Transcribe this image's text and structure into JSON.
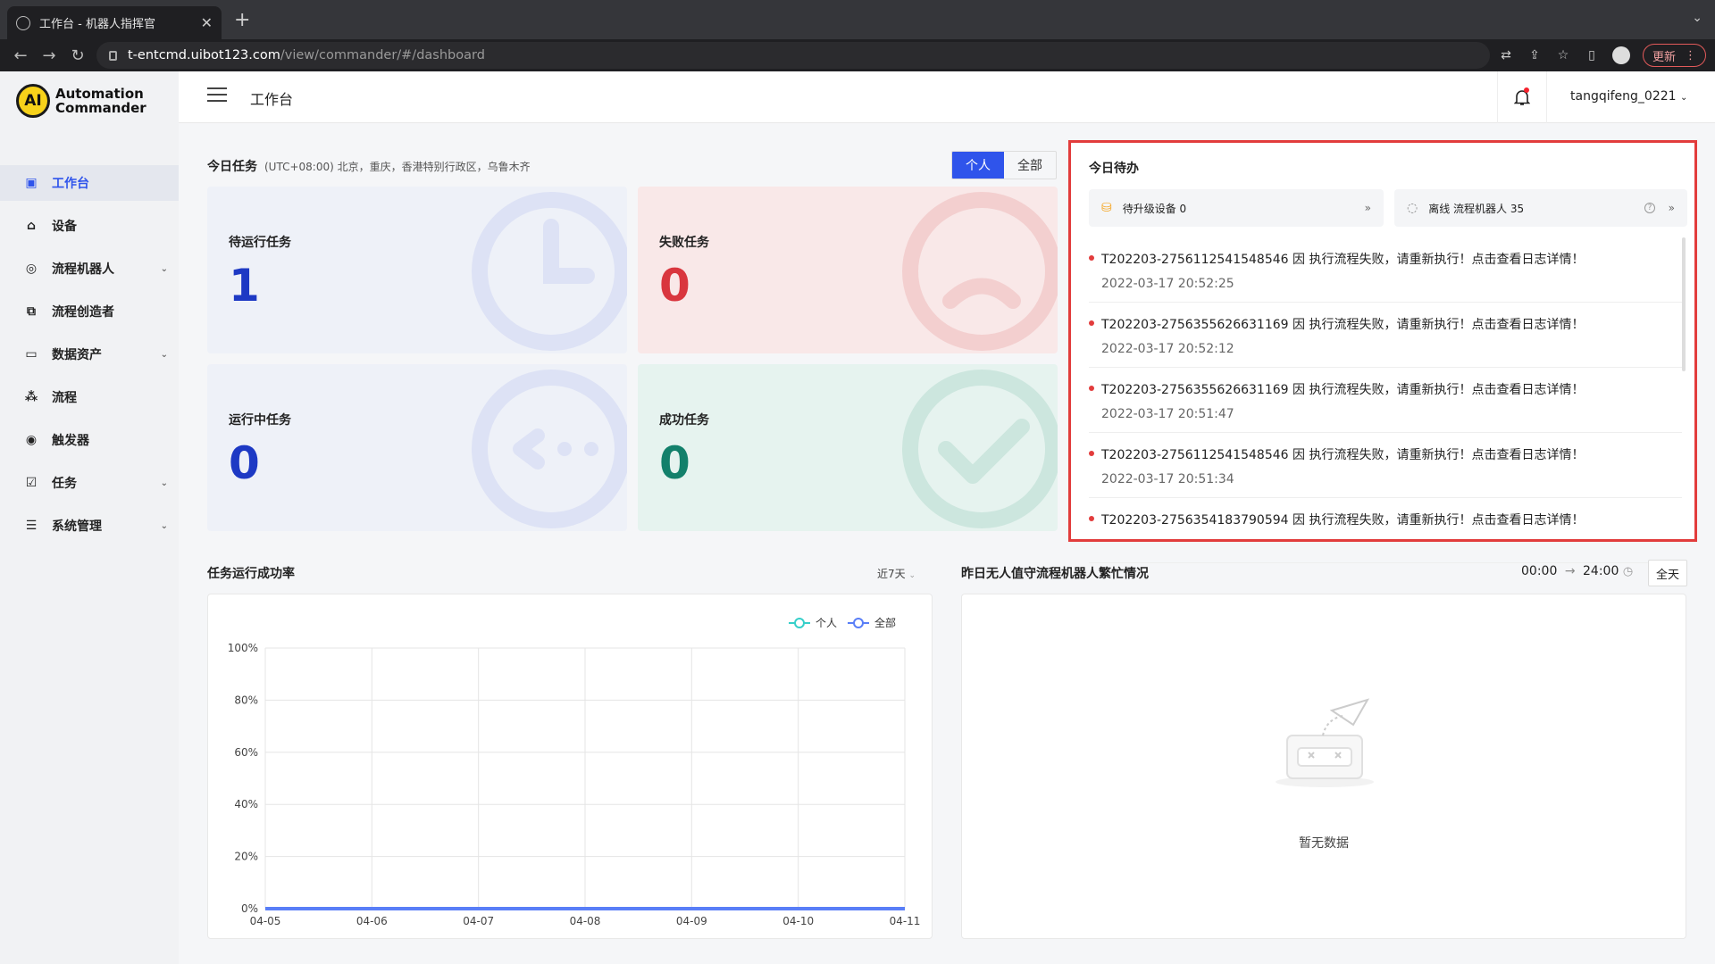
{
  "browser": {
    "tab_title": "工作台 - 机器人指挥官",
    "url_host": "t-entcmd.uibot123.com",
    "url_path": "/view/commander/#/dashboard",
    "update_label": "更新"
  },
  "brand": {
    "line1": "Automation",
    "line2": "Commander",
    "mark": "AI"
  },
  "sidebar": {
    "items": [
      {
        "label": "工作台",
        "icon": "dashboard-icon",
        "active": true,
        "chevron": false
      },
      {
        "label": "设备",
        "icon": "device-icon",
        "chevron": false
      },
      {
        "label": "流程机器人",
        "icon": "robot-icon",
        "chevron": true
      },
      {
        "label": "流程创造者",
        "icon": "creator-icon",
        "chevron": false
      },
      {
        "label": "数据资产",
        "icon": "folder-icon",
        "chevron": true
      },
      {
        "label": "流程",
        "icon": "flow-icon",
        "chevron": false
      },
      {
        "label": "触发器",
        "icon": "trigger-icon",
        "chevron": false
      },
      {
        "label": "任务",
        "icon": "task-icon",
        "chevron": true
      },
      {
        "label": "系统管理",
        "icon": "settings-icon",
        "chevron": true
      }
    ]
  },
  "header": {
    "title": "工作台",
    "user": "tangqifeng_0221"
  },
  "today": {
    "title": "今日任务",
    "timezone": "(UTC+08:00) 北京，重庆，香港特别行政区，乌鲁木齐",
    "seg_personal": "个人",
    "seg_all": "全部",
    "cards": [
      {
        "label": "待运行任务",
        "value": "1",
        "color": "#1d39c4"
      },
      {
        "label": "失败任务",
        "value": "0",
        "color": "#d9363e"
      },
      {
        "label": "运行中任务",
        "value": "0",
        "color": "#1d39c4"
      },
      {
        "label": "成功任务",
        "value": "0",
        "color": "#13806b"
      }
    ]
  },
  "todo": {
    "title": "今日待办",
    "pill1": "待升级设备 0",
    "pill2": "离线 流程机器人 35",
    "items": [
      {
        "text": "T202203-2756112541548546 因 执行流程失败，请重新执行！点击查看日志详情！",
        "time": "2022-03-17 20:52:25"
      },
      {
        "text": "T202203-2756355626631169 因 执行流程失败，请重新执行！点击查看日志详情！",
        "time": "2022-03-17 20:52:12"
      },
      {
        "text": "T202203-2756355626631169 因 执行流程失败，请重新执行！点击查看日志详情！",
        "time": "2022-03-17 20:51:47"
      },
      {
        "text": "T202203-2756112541548546 因 执行流程失败，请重新执行！点击查看日志详情！",
        "time": "2022-03-17 20:51:34"
      },
      {
        "text": "T202203-2756354183790594 因 执行流程失败，请重新执行！点击查看日志详情！",
        "time": ""
      }
    ]
  },
  "success": {
    "title": "任务运行成功率",
    "range": "近7天"
  },
  "busy": {
    "title": "昨日无人值守流程机器人繁忙情况",
    "start": "00:00",
    "arrow": "→",
    "end": "24:00",
    "allday": "全天",
    "empty": "暂无数据"
  },
  "chart_data": {
    "type": "line",
    "categories": [
      "04-05",
      "04-06",
      "04-07",
      "04-08",
      "04-09",
      "04-10",
      "04-11"
    ],
    "series": [
      {
        "name": "个人",
        "values": [
          0,
          0,
          0,
          0,
          0,
          0,
          0
        ],
        "color": "#36cfc9"
      },
      {
        "name": "全部",
        "values": [
          0,
          0,
          0,
          0,
          0,
          0,
          0
        ],
        "color": "#597ef7"
      }
    ],
    "y_ticks": [
      "0%",
      "20%",
      "40%",
      "60%",
      "80%",
      "100%"
    ],
    "ylim": [
      0,
      100
    ],
    "grid": true,
    "legend": "top-right"
  }
}
